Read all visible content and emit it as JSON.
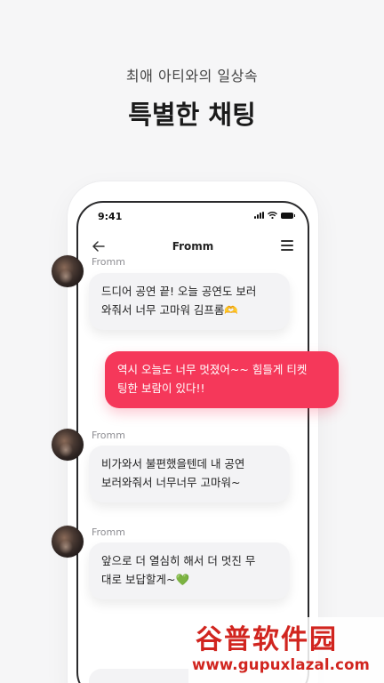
{
  "promo": {
    "subtitle": "최애 아티와의 일상속",
    "headline": "특별한 채팅"
  },
  "status_bar": {
    "time": "9:41"
  },
  "nav": {
    "title": "Fromm"
  },
  "messages": [
    {
      "sender": "Fromm",
      "direction": "incoming",
      "lines": [
        "드디어 공연 끝! 오늘 공연도 보러",
        "와줘서 너무 고마워 김프롬🫶"
      ]
    },
    {
      "sender": "",
      "direction": "outgoing",
      "lines": [
        "역시 오늘도 너무 멋졌어~~ 힘들게 티켓",
        "팅한 보람이 있다!!"
      ]
    },
    {
      "sender": "Fromm",
      "direction": "incoming",
      "lines": [
        "비가와서 불편했을텐데 내 공연",
        "보러와줘서 너무너무 고마워~"
      ]
    },
    {
      "sender": "Fromm",
      "direction": "incoming",
      "lines": [
        "앞으로 더 열심히 해서 더 멋진 무",
        "대로 보답할게~💚"
      ]
    }
  ],
  "watermark": {
    "title": "谷普软件园",
    "url": "www.gupuxlazal.com"
  },
  "colors": {
    "outgoing_bubble": "#f5385a",
    "incoming_bubble": "#f3f3f5",
    "watermark": "#d1251f"
  }
}
